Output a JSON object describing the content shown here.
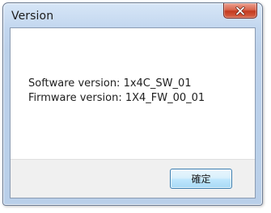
{
  "window": {
    "title": "Version"
  },
  "title_bar": {
    "close_icon": "close-icon",
    "close_accent": "#c9452a"
  },
  "content": {
    "software_version": "Software version: 1x4C_SW_01",
    "firmware_version": "Firmware version: 1X4_FW_00_01"
  },
  "footer": {
    "ok_label": "確定"
  }
}
